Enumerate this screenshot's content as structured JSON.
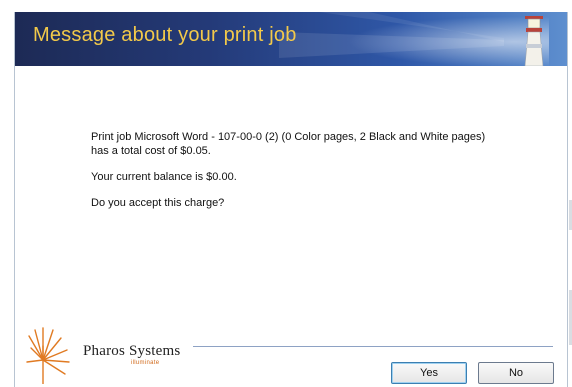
{
  "dialog": {
    "title": "Message about your print job",
    "message": {
      "line1": "Print job Microsoft Word - 107-00-0 (2) (0 Color pages, 2 Black and White pages)",
      "line2": "has a total cost of $0.05.",
      "balance": "Your current balance is $0.00.",
      "question": "Do you accept this charge?"
    },
    "logo": {
      "name": "Pharos Systems",
      "subtitle": "illuminate"
    },
    "buttons": {
      "yes": "Yes",
      "no": "No"
    }
  },
  "colors": {
    "banner_dark": "#1d2a55",
    "banner_light": "#5e8fcf",
    "title_text": "#f2c94a",
    "logo_accent": "#d26c1f"
  },
  "icons": {
    "lighthouse": "lighthouse-icon",
    "logo_burst": "pharos-burst-icon"
  }
}
